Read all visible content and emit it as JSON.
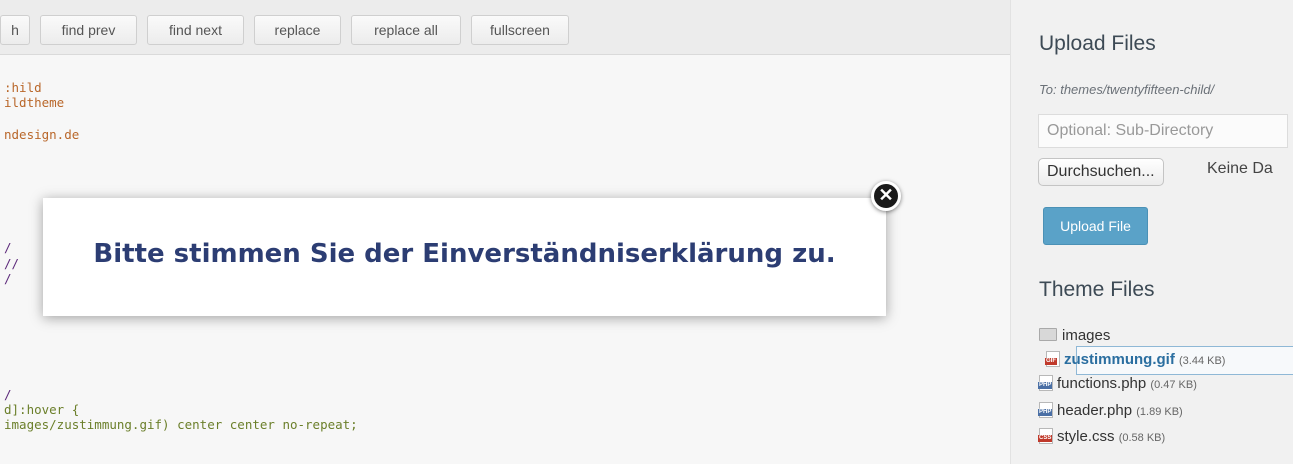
{
  "toolbar": {
    "buttons": [
      "h",
      "find prev",
      "find next",
      "replace",
      "replace all",
      "fullscreen"
    ]
  },
  "code": {
    "lines": [
      ":hild",
      "ildtheme",
      "ndesign.de",
      "/",
      "//",
      "/",
      "/",
      "d]:hover {",
      "images/zustimmung.gif) center center no-repeat;"
    ]
  },
  "dialog": {
    "message": "Bitte stimmen Sie der Einverständniserklärung zu.",
    "close_icon": "close-icon"
  },
  "upload": {
    "title": "Upload Files",
    "target": "To: themes/twentyfifteen-child/",
    "subdir_placeholder": "Optional: Sub-Directory",
    "browse_label": "Durchsuchen...",
    "no_file_text": "Keine Da",
    "upload_button": "Upload File"
  },
  "theme_files": {
    "title": "Theme Files",
    "folder": "images",
    "files": [
      {
        "name": "zustimmung.gif",
        "size": "(3.44 KB)",
        "type": "GIF",
        "selected": true
      },
      {
        "name": "functions.php",
        "size": "(0.47 KB)",
        "type": "PHP"
      },
      {
        "name": "header.php",
        "size": "(1.89 KB)",
        "type": "PHP"
      },
      {
        "name": "style.css",
        "size": "(0.58 KB)",
        "type": "CSS"
      }
    ]
  },
  "colors": {
    "dialog_text": "#2c3d73",
    "upload_button": "#5aa2c8",
    "selected_file": "#2a6ea0"
  }
}
